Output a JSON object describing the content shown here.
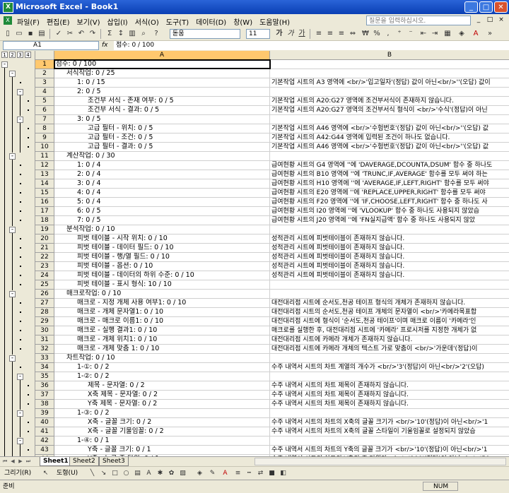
{
  "window": {
    "title": "Microsoft Excel - Book1",
    "controls": [
      "_",
      "□",
      "✕"
    ]
  },
  "menu": {
    "items": [
      "파일(F)",
      "편집(E)",
      "보기(V)",
      "삽입(I)",
      "서식(O)",
      "도구(T)",
      "데이터(D)",
      "창(W)",
      "도움말(H)"
    ],
    "help_placeholder": "질문을 입력하십시오.",
    "mdi": [
      "_",
      "□",
      "×"
    ]
  },
  "toolbar": {
    "font": "돋움",
    "size": "11",
    "bold": "가",
    "italic": "가",
    "underline": "가",
    "currency": "₩",
    "percent": "%"
  },
  "formula_bar": {
    "name_box": "A1",
    "fx": "fx",
    "content": "점수: 0 / 100"
  },
  "outline": {
    "levels": [
      "1",
      "2",
      "3",
      "4"
    ]
  },
  "columns": {
    "a": "A",
    "b": "B"
  },
  "rows": [
    {
      "n": "1",
      "a": "점수: 0 / 100",
      "b": ""
    },
    {
      "n": "2",
      "a": "서식작업: 0 / 25",
      "b": ""
    },
    {
      "n": "3",
      "a": "1: 0 / 15",
      "b": "기본작업 시트의 A3 영역에 <br/>'입고일자'(정답) 값이 아닌<br/>''(오답) 값이"
    },
    {
      "n": "4",
      "a": "2: 0 / 5",
      "b": ""
    },
    {
      "n": "5",
      "a": "조건부 서식 - 존재 여부: 0 / 5",
      "b": "기본작업 시트의 A20:G27 영역에 조건부서식이 존재하지 않습니다."
    },
    {
      "n": "6",
      "a": "조건부 서식 - 결과: 0 / 5",
      "b": "기본작업 시트의 A20:G27 영역의 조건부서식 형식이 <br/>'수식'(정답)이 아닌"
    },
    {
      "n": "7",
      "a": "3: 0 / 5",
      "b": ""
    },
    {
      "n": "8",
      "a": "고급 필터 - 위치: 0 / 5",
      "b": "기본작업 시트의 A46 영역에 <br/>'수험번호'(정답) 값이 아닌<br/>''(오답) 값"
    },
    {
      "n": "9",
      "a": "고급 필터 - 조건: 0 / 5",
      "b": "기본작업 시트의 A42:G44 영역에 입력된 조건이 하나도 없습니다."
    },
    {
      "n": "10",
      "a": "고급 필터 - 결과: 0 / 5",
      "b": "기본작업 시트의 A46 영역에 <br/>'수험번호'(정답) 값이 아닌<br/>''(오답) 값"
    },
    {
      "n": "11",
      "a": "계산작업: 0 / 30",
      "b": ""
    },
    {
      "n": "12",
      "a": "1: 0 / 4",
      "b": "급여현황 시트의 G4 영역에 ''에 'DAVERAGE,DCOUNTA,DSUM' 함수 중 하나도"
    },
    {
      "n": "13",
      "a": "2: 0 / 4",
      "b": "급여현황 시트의 B10 영역에 ''에 'TRUNC,IF,AVERAGE' 함수를 모두 써야 하는"
    },
    {
      "n": "14",
      "a": "3: 0 / 4",
      "b": "급여현황 시트의 H10 영역에 ''에 'AVERAGE,IF,LEFT,RIGHT' 함수를 모두 써야"
    },
    {
      "n": "15",
      "a": "4: 0 / 4",
      "b": "급여현황 시트의 E20 영역에 ''에 'REPLACE,UPPER,RIGHT' 함수를 모두 써야"
    },
    {
      "n": "16",
      "a": "5: 0 / 4",
      "b": "급여현황 시트의 F20 영역에 ''에 'IF,CHOOSE,LEFT,RIGHT' 함수 중 하나도 사"
    },
    {
      "n": "17",
      "a": "6: 0 / 5",
      "b": "급여현황 시트의 I20 영역에 ''에 'VLOOKUP' 함수 중 하나도 사용되지 않았습"
    },
    {
      "n": "18",
      "a": "7: 0 / 5",
      "b": "급여현황 시트의 J20 영역에 ''에 'FN실지급액' 함수 중 하나도 사용되지 않았"
    },
    {
      "n": "19",
      "a": "분석작업: 0 / 10",
      "b": ""
    },
    {
      "n": "20",
      "a": "피벗 테이블 - 시작 위치: 0 / 10",
      "b": "성적관리 시트에 피벗테이블이 존재하지 않습니다."
    },
    {
      "n": "21",
      "a": "피벗 테이블 - 데이터 필드: 0 / 10",
      "b": "성적관리 시트에 피벗테이블이 존재하지 않습니다."
    },
    {
      "n": "22",
      "a": "피벗 테이블 - 행/열 필드: 0 / 10",
      "b": "성적관리 시트에 피벗테이블이 존재하지 않습니다."
    },
    {
      "n": "23",
      "a": "피벗 테이블 - 옵션: 0 / 10",
      "b": "성적관리 시트에 피벗테이블이 존재하지 않습니다."
    },
    {
      "n": "24",
      "a": "피벗 테이블 - 데이터의 하위 수준: 0 / 10",
      "b": "성적관리 시트에 피벗테이블이 존재하지 않습니다."
    },
    {
      "n": "25",
      "a": "피벗 테이블 - 표시 형식: 10 / 10",
      "b": ""
    },
    {
      "n": "26",
      "a": "매크로작업: 0 / 10",
      "b": ""
    },
    {
      "n": "27",
      "a": "매크로 - 지정 개체 사용 여부1: 0 / 10",
      "b": "대전대리점 시트에 순서도,천공 테이프 형식의 개체가 존재하지 않습니다."
    },
    {
      "n": "28",
      "a": "매크로 - 개체 문자열1: 0 / 10",
      "b": "대전대리점 시트의 순서도,천공 테이프 개체의 문자열이 <br/>'카메라목표합"
    },
    {
      "n": "29",
      "a": "매크로 - 매크로 이름1: 0 / 10",
      "b": "대전대리점 시트에 형식이 '순서도,천공 테이프'이며 매크로 이름이 '카메라'인"
    },
    {
      "n": "30",
      "a": "매크로 - 실행 결과1: 0 / 10",
      "b": "매크로를 실행한 후, 대전대리점 시트에 '카메라' 프로시저를 지정한 개체가 없"
    },
    {
      "n": "31",
      "a": "매크로 - 개체 위치1: 0 / 10",
      "b": "대전대리점 시트에 카메라 개체가 존재하지 않습니다."
    },
    {
      "n": "32",
      "a": "매크로 - 개체 맞춤 1: 0 / 10",
      "b": "대전대리점 시트에 카메라 개체의 텍스트 가로 맞춤이 <br/>'가운데'(정답)이"
    },
    {
      "n": "33",
      "a": "차트작업: 0 / 10",
      "b": ""
    },
    {
      "n": "34",
      "a": "1-①: 0 / 2",
      "b": "수주 내역서 시트의 차트 계열의 개수가 <br/>'3'(정답)이 아닌<br/>'2'(오답)"
    },
    {
      "n": "35",
      "a": "1-②: 0 / 2",
      "b": ""
    },
    {
      "n": "36",
      "a": "제목 - 문자열: 0 / 2",
      "b": "수주 내역서 시트의 차트 제목이 존재하지 않습니다."
    },
    {
      "n": "37",
      "a": "X축 제목 - 문자열: 0 / 2",
      "b": "수주 내역서 시트의 차트 제목이 존재하지 않습니다."
    },
    {
      "n": "38",
      "a": "Y축 제목 - 문자열: 0 / 2",
      "b": "수주 내역서 시트의 차트 제목이 존재하지 않습니다."
    },
    {
      "n": "39",
      "a": "1-③: 0 / 2",
      "b": ""
    },
    {
      "n": "40",
      "a": "X축 - 글꼴 크기: 0 / 2",
      "b": "수주 내역서 시트의 차트의 X축의 글꼴 크기가 <br/>'10'(정답)이 아닌<br/>'1"
    },
    {
      "n": "41",
      "a": "X축 - 글꼴 기울임꼴: 0 / 2",
      "b": "수주 내역서 시트의 차트의 X축의 글꼴 스타일이 기울임꼴로 설정되지 않았습"
    },
    {
      "n": "42",
      "a": "1-④: 0 / 1",
      "b": ""
    },
    {
      "n": "43",
      "a": "Y축 - 글꼴 크기: 0 / 1",
      "b": "수주 내역서 시트의 차트의 Y축의 글꼴 크기가 <br/>'10'(정답)이 아닌<br/>'1"
    },
    {
      "n": "44",
      "a": "Y축 - 눈금 주 단위: 0 / 1",
      "b": "수주 내역서 시트의 차트의 Y축의 주 단위가 <br/>'100'(정답)이 아닌<br/>'50"
    }
  ],
  "sheets": [
    "Sheet1",
    "Sheet2",
    "Sheet3"
  ],
  "drawing": {
    "draw_label": "그리기(R)",
    "shapes_label": "도형(U)"
  },
  "status": {
    "ready": "준비",
    "num": "NUM"
  },
  "colors": {
    "title_blue": "#0a3fb4",
    "header_selected": "#ffc86e",
    "chrome": "#ece9d8"
  }
}
